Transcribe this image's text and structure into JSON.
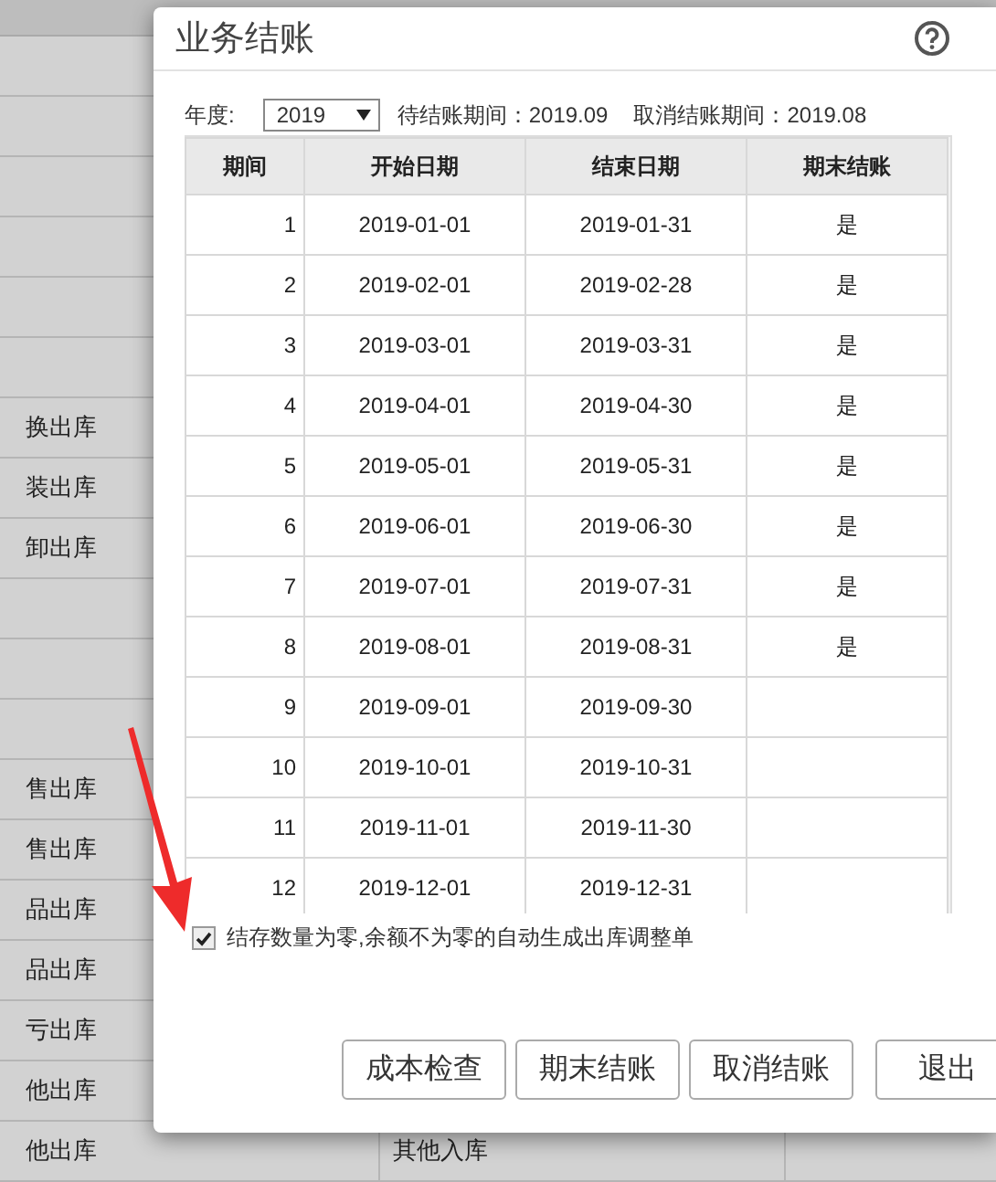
{
  "background_table": {
    "rows": [
      {},
      {},
      {},
      {},
      {},
      {},
      {
        "column_1": "换出库"
      },
      {
        "column_1": "装出库"
      },
      {
        "column_1": "卸出库"
      },
      {},
      {},
      {},
      {
        "column_1": "售出库"
      },
      {
        "column_1": "售出库"
      },
      {
        "column_1": "品出库"
      },
      {
        "column_1": "品出库"
      },
      {
        "column_1": "亏出库"
      },
      {
        "column_1": "他出库"
      },
      {
        "column_1": "他出库",
        "column_2": "其他入库"
      }
    ]
  },
  "dialog": {
    "title": "业务结账",
    "year_label": "年度:",
    "year_select": {
      "value": "2019"
    },
    "pending_period": "待结账期间：2019.09",
    "cancel_period": "取消结账期间：2019.08",
    "table": {
      "columns": [
        "期间",
        "开始日期",
        "结束日期",
        "期末结账"
      ],
      "rows": [
        {
          "period": "1",
          "start": "2019-01-01",
          "end": "2019-01-31",
          "closed": "是"
        },
        {
          "period": "2",
          "start": "2019-02-01",
          "end": "2019-02-28",
          "closed": "是"
        },
        {
          "period": "3",
          "start": "2019-03-01",
          "end": "2019-03-31",
          "closed": "是"
        },
        {
          "period": "4",
          "start": "2019-04-01",
          "end": "2019-04-30",
          "closed": "是"
        },
        {
          "period": "5",
          "start": "2019-05-01",
          "end": "2019-05-31",
          "closed": "是"
        },
        {
          "period": "6",
          "start": "2019-06-01",
          "end": "2019-06-30",
          "closed": "是"
        },
        {
          "period": "7",
          "start": "2019-07-01",
          "end": "2019-07-31",
          "closed": "是"
        },
        {
          "period": "8",
          "start": "2019-08-01",
          "end": "2019-08-31",
          "closed": "是"
        },
        {
          "period": "9",
          "start": "2019-09-01",
          "end": "2019-09-30"
        },
        {
          "period": "10",
          "start": "2019-10-01",
          "end": "2019-10-31"
        },
        {
          "period": "11",
          "start": "2019-11-01",
          "end": "2019-11-30"
        },
        {
          "period": "12",
          "start": "2019-12-01",
          "end": "2019-12-31"
        }
      ]
    },
    "option": {
      "label": "结存数量为零,余额不为零的自动生成出库调整单",
      "checked": true
    },
    "buttons": [
      "成本检查",
      "期末结账",
      "取消结账",
      "退出"
    ]
  }
}
